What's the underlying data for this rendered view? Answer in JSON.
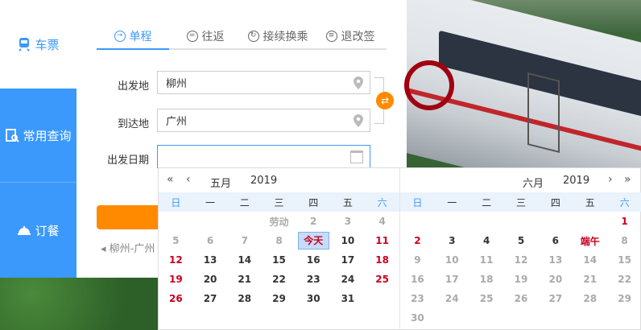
{
  "sidebar": {
    "items": [
      {
        "label": "车票",
        "icon": "train-icon"
      },
      {
        "label": "常用查询",
        "icon": "clipboard-search-icon"
      },
      {
        "label": "订餐",
        "icon": "cloche-icon"
      }
    ]
  },
  "tabs": [
    {
      "label": "单程",
      "active": true
    },
    {
      "label": "往返"
    },
    {
      "label": "接续换乘"
    },
    {
      "label": "退改签"
    }
  ],
  "form": {
    "from_label": "出发地",
    "from_value": "柳州",
    "to_label": "到达地",
    "to_value": "广州",
    "date_label": "出发日期",
    "date_value": "",
    "swap_glyph": "⇄",
    "history": "◂ 柳州-广州"
  },
  "calendar": {
    "left": {
      "month": "五月",
      "year": "2019",
      "weekdays": [
        "日",
        "一",
        "二",
        "三",
        "四",
        "五",
        "六"
      ],
      "days": [
        {
          "t": ""
        },
        {
          "t": ""
        },
        {
          "t": ""
        },
        {
          "t": "劳动",
          "c": "grey"
        },
        {
          "t": "2",
          "c": "grey"
        },
        {
          "t": "3",
          "c": "grey"
        },
        {
          "t": "4",
          "c": "grey"
        },
        {
          "t": "5",
          "c": "grey"
        },
        {
          "t": "6",
          "c": "grey"
        },
        {
          "t": "7",
          "c": "grey"
        },
        {
          "t": "8",
          "c": "grey"
        },
        {
          "t": "今天",
          "c": "today"
        },
        {
          "t": "10"
        },
        {
          "t": "11",
          "c": "red"
        },
        {
          "t": "12",
          "c": "red"
        },
        {
          "t": "13"
        },
        {
          "t": "14"
        },
        {
          "t": "15"
        },
        {
          "t": "16"
        },
        {
          "t": "17"
        },
        {
          "t": "18",
          "c": "red"
        },
        {
          "t": "19",
          "c": "red"
        },
        {
          "t": "20"
        },
        {
          "t": "21"
        },
        {
          "t": "22"
        },
        {
          "t": "23"
        },
        {
          "t": "24"
        },
        {
          "t": "25",
          "c": "red"
        },
        {
          "t": "26",
          "c": "red"
        },
        {
          "t": "27"
        },
        {
          "t": "28"
        },
        {
          "t": "29"
        },
        {
          "t": "30"
        },
        {
          "t": "31"
        }
      ]
    },
    "right": {
      "month": "六月",
      "year": "2019",
      "weekdays": [
        "日",
        "一",
        "二",
        "三",
        "四",
        "五",
        "六"
      ],
      "days": [
        {
          "t": ""
        },
        {
          "t": ""
        },
        {
          "t": ""
        },
        {
          "t": ""
        },
        {
          "t": ""
        },
        {
          "t": ""
        },
        {
          "t": "1",
          "c": "red"
        },
        {
          "t": "2",
          "c": "red"
        },
        {
          "t": "3"
        },
        {
          "t": "4"
        },
        {
          "t": "5"
        },
        {
          "t": "6"
        },
        {
          "t": "端午",
          "c": "festival"
        },
        {
          "t": "8",
          "c": "grey"
        },
        {
          "t": "9",
          "c": "grey"
        },
        {
          "t": "10",
          "c": "grey"
        },
        {
          "t": "11",
          "c": "grey"
        },
        {
          "t": "12",
          "c": "grey"
        },
        {
          "t": "13",
          "c": "grey"
        },
        {
          "t": "14",
          "c": "grey"
        },
        {
          "t": "15",
          "c": "grey"
        },
        {
          "t": "16",
          "c": "grey"
        },
        {
          "t": "17",
          "c": "grey"
        },
        {
          "t": "18",
          "c": "grey"
        },
        {
          "t": "19",
          "c": "grey"
        },
        {
          "t": "20",
          "c": "grey"
        },
        {
          "t": "21",
          "c": "grey"
        },
        {
          "t": "22",
          "c": "grey"
        },
        {
          "t": "23",
          "c": "grey"
        },
        {
          "t": "24",
          "c": "grey"
        },
        {
          "t": "25",
          "c": "grey"
        },
        {
          "t": "26",
          "c": "grey"
        },
        {
          "t": "27",
          "c": "grey"
        },
        {
          "t": "28",
          "c": "grey"
        },
        {
          "t": "29",
          "c": "grey"
        },
        {
          "t": "30",
          "c": "grey"
        }
      ]
    },
    "nav": {
      "prev_year": "«",
      "prev_month": "‹",
      "next_month": "›",
      "next_year": "»"
    }
  },
  "colors": {
    "accent": "#3b99fc",
    "orange": "#ff8a00",
    "holiday_red": "#c8001e"
  }
}
